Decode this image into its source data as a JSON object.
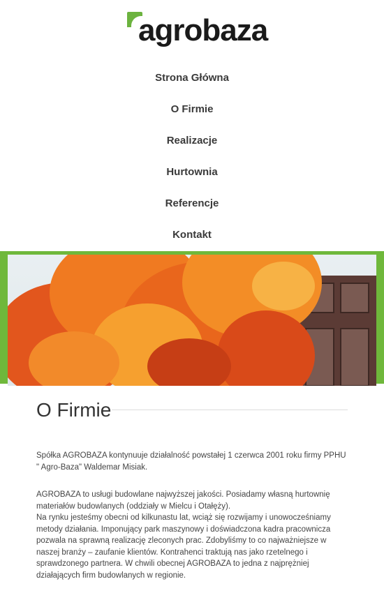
{
  "logo": {
    "text": "agrobaza"
  },
  "nav": [
    {
      "label": "Strona Główna"
    },
    {
      "label": "O Firmie"
    },
    {
      "label": "Realizacje"
    },
    {
      "label": "Hurtownia"
    },
    {
      "label": "Referencje"
    },
    {
      "label": "Kontakt"
    }
  ],
  "colors": {
    "accent": "#6fb83b",
    "text": "#444444"
  },
  "main": {
    "title": "O Firmie",
    "paragraph1": "Spółka AGROBAZA kontynuuje działalność powstałej 1 czerwca 2001 roku firmy PPHU \" Agro-Baza\" Waldemar Misiak.",
    "paragraph2": "AGROBAZA to usługi budowlane najwyższej jakości. Posiadamy własną hurtownię materiałów budowlanych (oddziały w Mielcu i Otałęży).",
    "paragraph3": "Na rynku jesteśmy obecni od kilkunastu lat, wciąż się rozwijamy i unowocześniamy metody działania. Imponujący park maszynowy i doświadczona kadra pracownicza pozwala na sprawną realizację zleconych prac. Zdobyliśmy to co najważniejsze w naszej branży – zaufanie klientów. Kontrahenci traktują nas jako rzetelnego i sprawdzonego partnera. W chwili obecnej AGROBAZA to jedna z najprężniej działających firm budowlanych w regionie."
  }
}
